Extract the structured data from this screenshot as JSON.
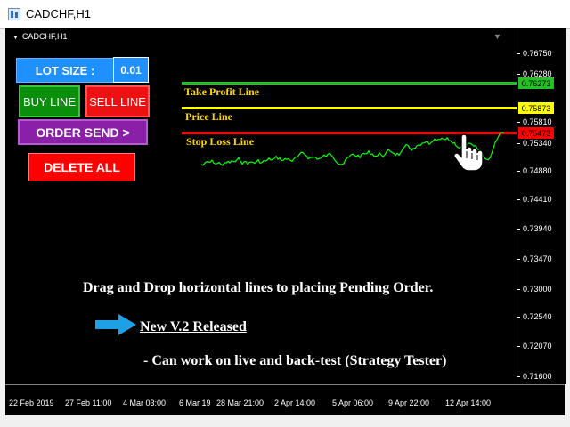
{
  "window": {
    "title": "CADCHF,H1"
  },
  "chart": {
    "symbol_label": "CADCHF,H1"
  },
  "panel": {
    "lot_label": "LOT SIZE :",
    "lot_value": "0.01",
    "buy_line": "BUY LINE",
    "sell_line": "SELL LINE",
    "order_send": "ORDER SEND >",
    "delete_all": "DELETE ALL"
  },
  "lines": {
    "take_profit": {
      "label": "Take Profit Line",
      "price": "0.76273",
      "color": "#22c022"
    },
    "price": {
      "label": "Price Line",
      "price": "0.75873",
      "color": "#ffff00"
    },
    "stop_loss": {
      "label": "Stop Loss Line",
      "price": "0.75473",
      "color": "#ff0000"
    }
  },
  "price_axis": [
    "0.76750",
    "0.76280",
    "0.75810",
    "0.75340",
    "0.74880",
    "0.74410",
    "0.73940",
    "0.73470",
    "0.73000",
    "0.72540",
    "0.72070",
    "0.71600"
  ],
  "time_axis": [
    "22 Feb 2019",
    "27 Feb 11:00",
    "4 Mar 03:00",
    "6 Mar 19",
    "28 Mar 21:00",
    "2 Apr 14:00",
    "5 Apr 06:00",
    "9 Apr 22:00",
    "12 Apr 14:00"
  ],
  "captions": {
    "main": "Drag and Drop horizontal lines to placing Pending Order.",
    "release": "New V.2 Released",
    "note": "- Can work on live and back-test (Strategy Tester)"
  },
  "colors": {
    "price_series": "#00ff00",
    "arrow": "#1ea0e6"
  },
  "icons": {
    "pointer": "hand-pointer-icon",
    "arrow": "arrow-right-icon"
  }
}
